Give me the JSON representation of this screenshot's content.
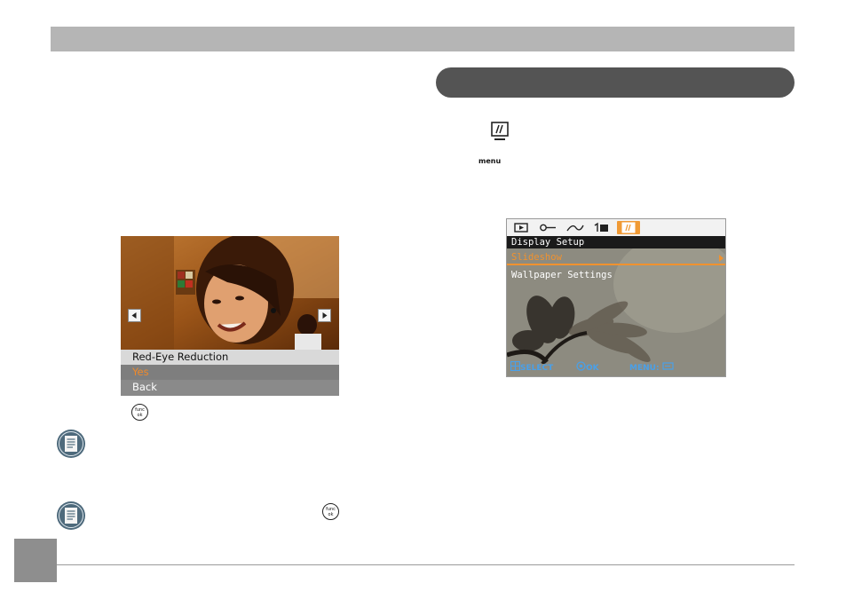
{
  "camera_screen": {
    "menu_title": "Red-Eye Reduction",
    "option_selected": "Yes",
    "option_back": "Back"
  },
  "func_button": {
    "top": "func",
    "bottom": "ok"
  },
  "menu_button_label": "menu",
  "setup_screen": {
    "header": "Display Setup",
    "items": [
      {
        "label": "Slideshow",
        "selected": true
      },
      {
        "label": "Wallpaper Settings",
        "selected": false
      }
    ],
    "footer": {
      "select": "SELECT",
      "ok": "OK",
      "menu": "MENU:"
    },
    "tab_icons": [
      "playback-icon",
      "key-icon",
      "curve-icon",
      "delete-icon",
      "display-setup-icon"
    ]
  },
  "colors": {
    "highlight_orange": "#f0922f",
    "header_bar_gray": "#b5b5b5",
    "section_pill": "#545454",
    "footer_blue": "#4aa0e8"
  }
}
